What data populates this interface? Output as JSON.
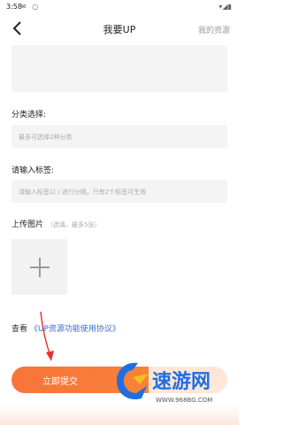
{
  "status": {
    "time": "3:58",
    "icons": [
      "email-icon",
      "circle-icon"
    ]
  },
  "header": {
    "title": "我要UP",
    "right_link": "我的资源"
  },
  "form": {
    "category_label": "分类选择:",
    "category_placeholder": "最多可选择2种分类",
    "tag_label": "请输入标签:",
    "tag_placeholder": "请输入标签以 / 进行分隔，只有2个标签可生效",
    "upload_label": "上传图片",
    "upload_hint": "（选填，最多5张）"
  },
  "agreement": {
    "prefix": "查看",
    "link": "《UP资源功能使用协议》"
  },
  "submit": {
    "label": "立即提交"
  },
  "watermark": {
    "brand": "速游网",
    "url": "WWW.968BG.COM"
  },
  "colors": {
    "accent": "#f7743a",
    "link": "#3a6ad9",
    "arrow": "#e8302a"
  }
}
